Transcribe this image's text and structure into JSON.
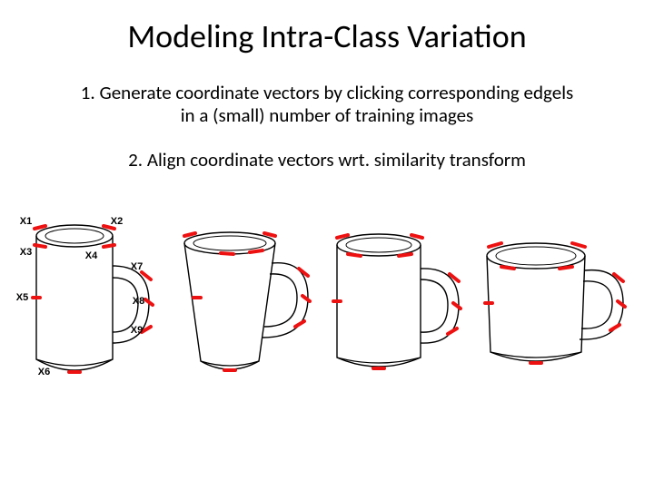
{
  "title": "Modeling Intra-Class Variation",
  "step1_line1": "1. Generate coordinate vectors by clicking corresponding edgels",
  "step1_line2": "in a (small) number of training images",
  "step2": "2. Align coordinate vectors wrt. similarity transform",
  "labels": {
    "x1": "X1",
    "x2": "X2",
    "x3": "X3",
    "x4": "X4",
    "x5": "X5",
    "x6": "X6",
    "x7": "X7",
    "x8": "X8",
    "x9": "X9"
  }
}
